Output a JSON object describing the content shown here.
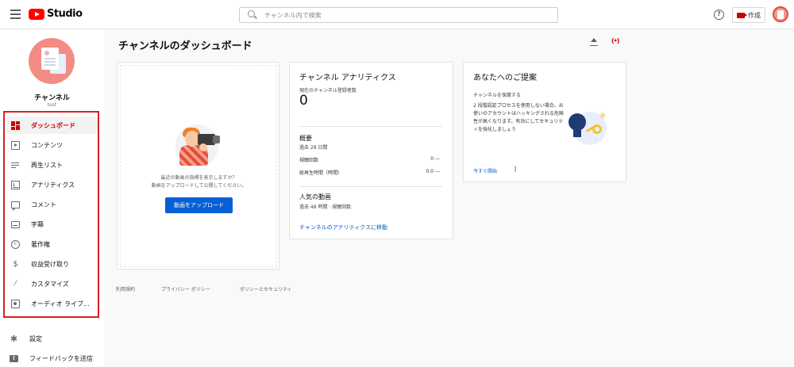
{
  "header": {
    "logo_text": "Studio",
    "search_placeholder": "チャンネル内で検索",
    "help_glyph": "?",
    "create_label": "作成"
  },
  "sidebar": {
    "channel_name": "チャンネル",
    "channel_handle": "test",
    "nav_items": [
      {
        "label": "ダッシュボード",
        "icon": "dashboard-icon",
        "active": true
      },
      {
        "label": "コンテンツ",
        "icon": "content-icon",
        "active": false
      },
      {
        "label": "再生リスト",
        "icon": "playlist-icon",
        "active": false
      },
      {
        "label": "アナリティクス",
        "icon": "analytics-icon",
        "active": false
      },
      {
        "label": "コメント",
        "icon": "comment-icon",
        "active": false
      },
      {
        "label": "字幕",
        "icon": "subtitles-icon",
        "active": false
      },
      {
        "label": "著作権",
        "icon": "copyright-icon",
        "active": false
      },
      {
        "label": "収益受け取り",
        "icon": "dollar-icon",
        "active": false
      },
      {
        "label": "カスタマイズ",
        "icon": "magic-wand-icon",
        "active": false
      },
      {
        "label": "オーディオ ライブ...",
        "icon": "audio-library-icon",
        "active": false
      }
    ],
    "bottom_items": [
      {
        "label": "設定",
        "icon": "gear-icon"
      },
      {
        "label": "フィードバックを送信",
        "icon": "feedback-icon"
      }
    ]
  },
  "main": {
    "page_title": "チャンネルのダッシュボード",
    "upload_card": {
      "line1": "最近の動画の指標を表示しますか？",
      "line2": "動画をアップロードして公開してください。",
      "button_label": "動画をアップロード"
    },
    "analytics_card": {
      "title": "チャンネル アナリティクス",
      "subs_label": "現在のチャンネル登録者数",
      "subs_value": "0",
      "summary_title": "概要",
      "summary_period": "過去 28 日間",
      "rows": [
        {
          "label": "視聴回数",
          "value": "0 —"
        },
        {
          "label": "総再生時間（時間）",
          "value": "0.0 —"
        }
      ],
      "popular_title": "人気の動画",
      "popular_period": "過去 48 時間 · 視聴回数",
      "link": "チャンネルのアナリティクスに移動"
    },
    "idea_card": {
      "title": "あなたへのご提案",
      "subtitle": "チャンネルを保護する",
      "body": "2 段階認証プロセスを使用しない場合、お使いのアカウントはハッキングされる危険性が高くなります。有効にしてセキュリティを強化しましょう",
      "action": "今すぐ開始",
      "more_glyph": "⋮"
    },
    "footer_links": [
      "利用規約",
      "プライバシー ポリシー",
      "ポリシーとセキュリティ"
    ]
  },
  "colors": {
    "brand_red": "#ff0000",
    "active_red": "#cc0000",
    "link_blue": "#065fd4",
    "highlight_frame": "#d9201f"
  }
}
